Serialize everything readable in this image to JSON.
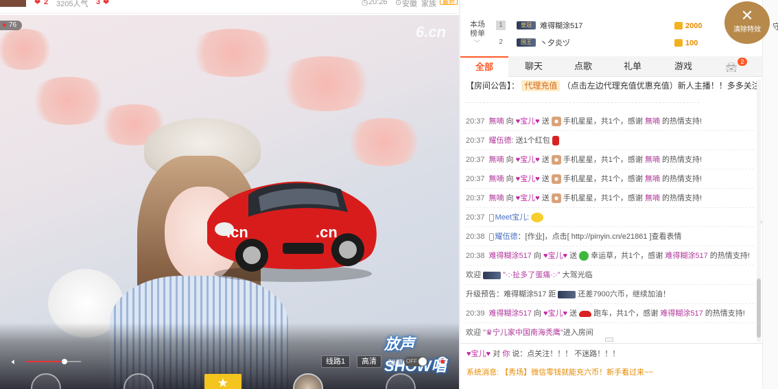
{
  "top_strip": {
    "count_text": "3205人气",
    "time": "20:26",
    "nav": [
      "安徽",
      "家族"
    ],
    "badge": "最新"
  },
  "video": {
    "viewer_count": "76",
    "watermark": "6.cn",
    "logo_text": "放声SHOW唱",
    "controls": {
      "volume_level": 0.7,
      "line_button": "线路1",
      "quality_button": "高清",
      "danmu_label": "弹幕",
      "danmu_state": "OFF"
    }
  },
  "rank": {
    "title": "本场榜单",
    "rows": [
      {
        "rank": "1",
        "medal": "皇冠",
        "name": "难得糊涂517",
        "score": "2000"
      },
      {
        "rank": "2",
        "medal": "国王",
        "name": "丶夕炎ヅ",
        "score": "100"
      }
    ]
  },
  "clear_effects": {
    "label": "清除特效"
  },
  "right_edge": {
    "guard_label": "守"
  },
  "tabs": [
    {
      "label": "全部",
      "active": true
    },
    {
      "label": "聊天",
      "active": false
    },
    {
      "label": "点歌",
      "active": false
    },
    {
      "label": "礼单",
      "active": false
    },
    {
      "label": "游戏",
      "active": false
    }
  ],
  "tab_badge_count": "2",
  "notice": {
    "prefix": "【房间公告】：",
    "tag": "代理充值",
    "text": "（点击左边代理充值优惠充值）新人主播！！多多关注！！"
  },
  "chat": [
    {
      "time": "20:37",
      "user": "無喃",
      "to": "向",
      "target": "♥宝儿♥",
      "verb": "送",
      "gift": "手机星星，共1个，感谢",
      "thanks_user": "無喃",
      "suffix": "的热情支持!",
      "icon": "gift"
    },
    {
      "time": "20:37",
      "user": "耀伍德",
      "text": ": 送1个红包",
      "icon": "red"
    },
    {
      "time": "20:37",
      "user": "無喃",
      "to": "向",
      "target": "♥宝儿♥",
      "verb": "送",
      "gift": "手机星星，共1个，感谢",
      "thanks_user": "無喃",
      "suffix": "的热情支持!",
      "icon": "gift"
    },
    {
      "time": "20:37",
      "user": "無喃",
      "to": "向",
      "target": "♥宝儿♥",
      "verb": "送",
      "gift": "手机星星，共1个，感谢",
      "thanks_user": "無喃",
      "suffix": "的热情支持!",
      "icon": "gift"
    },
    {
      "time": "20:37",
      "user": "無喃",
      "to": "向",
      "target": "♥宝儿♥",
      "verb": "送",
      "gift": "手机星星，共1个，感谢",
      "thanks_user": "無喃",
      "suffix": "的热情支持!",
      "icon": "gift"
    },
    {
      "time": "20:37",
      "user": "Meet宝儿",
      "text": ":",
      "icon": "emoji",
      "phone": true
    },
    {
      "time": "20:38",
      "user": "耀伍德",
      "text": "：[作业]，点击[ http://pinyin.cn/e21861 ]查看表情",
      "phone": true
    },
    {
      "time": "20:38",
      "user": "难得糊涂517",
      "to": "向",
      "target": "♥宝儿♥",
      "verb": "送",
      "gift": "幸运草，共1个，感谢",
      "thanks_user": "难得糊涂517",
      "suffix": "的热情支持!",
      "icon": "clover"
    },
    {
      "welcome": "欢迎",
      "user": "\"·:·扯多了蛋痛·:·\"",
      "text": "大驾光临",
      "medal": true
    },
    {
      "upgrade": "升级预告：难得糊涂517 距",
      "text": "还差7900六币，继续加油！",
      "medal": true
    },
    {
      "time": "20:39",
      "user": "难得糊涂517",
      "to": "向",
      "target": "♥宝儿♥",
      "verb": "送",
      "gift": "跑车，共1个，感谢",
      "thanks_user": "难得糊涂517",
      "suffix": "的热情支持!",
      "icon": "car"
    },
    {
      "welcome": "欢迎",
      "user": "\"♛宁儿家中国南海秃鹰\"",
      "text": "进入房间"
    }
  ],
  "whisper": {
    "user": "♥宝儿♥",
    "mid": "对",
    "target": "你",
    "text": "说：点关注！！！ 不迷路！！！"
  },
  "system": {
    "label": "系统消息:",
    "text": "【秀场】微信零钱就能充六币！新手看过来~~"
  }
}
